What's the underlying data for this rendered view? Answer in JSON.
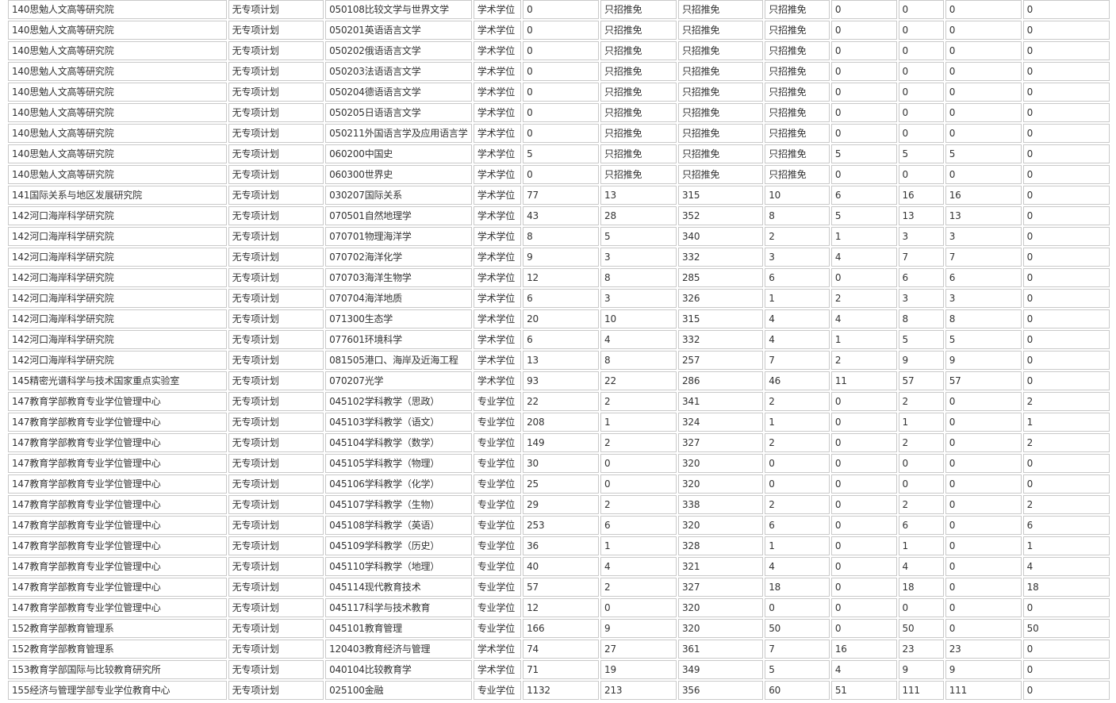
{
  "table": {
    "rows": [
      [
        "140思勉人文高等研究院",
        "无专项计划",
        "050108比较文学与世界文学",
        "学术学位",
        "0",
        "只招推免",
        "只招推免",
        "只招推免",
        "0",
        "0",
        "0",
        "0"
      ],
      [
        "140思勉人文高等研究院",
        "无专项计划",
        "050201英语语言文学",
        "学术学位",
        "0",
        "只招推免",
        "只招推免",
        "只招推免",
        "0",
        "0",
        "0",
        "0"
      ],
      [
        "140思勉人文高等研究院",
        "无专项计划",
        "050202俄语语言文学",
        "学术学位",
        "0",
        "只招推免",
        "只招推免",
        "只招推免",
        "0",
        "0",
        "0",
        "0"
      ],
      [
        "140思勉人文高等研究院",
        "无专项计划",
        "050203法语语言文学",
        "学术学位",
        "0",
        "只招推免",
        "只招推免",
        "只招推免",
        "0",
        "0",
        "0",
        "0"
      ],
      [
        "140思勉人文高等研究院",
        "无专项计划",
        "050204德语语言文学",
        "学术学位",
        "0",
        "只招推免",
        "只招推免",
        "只招推免",
        "0",
        "0",
        "0",
        "0"
      ],
      [
        "140思勉人文高等研究院",
        "无专项计划",
        "050205日语语言文学",
        "学术学位",
        "0",
        "只招推免",
        "只招推免",
        "只招推免",
        "0",
        "0",
        "0",
        "0"
      ],
      [
        "140思勉人文高等研究院",
        "无专项计划",
        "050211外国语言学及应用语言学",
        "学术学位",
        "0",
        "只招推免",
        "只招推免",
        "只招推免",
        "0",
        "0",
        "0",
        "0"
      ],
      [
        "140思勉人文高等研究院",
        "无专项计划",
        "060200中国史",
        "学术学位",
        "5",
        "只招推免",
        "只招推免",
        "只招推免",
        "5",
        "5",
        "5",
        "0"
      ],
      [
        "140思勉人文高等研究院",
        "无专项计划",
        "060300世界史",
        "学术学位",
        "0",
        "只招推免",
        "只招推免",
        "只招推免",
        "0",
        "0",
        "0",
        "0"
      ],
      [
        "141国际关系与地区发展研究院",
        "无专项计划",
        "030207国际关系",
        "学术学位",
        "77",
        "13",
        "315",
        "10",
        "6",
        "16",
        "16",
        "0"
      ],
      [
        "142河口海岸科学研究院",
        "无专项计划",
        "070501自然地理学",
        "学术学位",
        "43",
        "28",
        "352",
        "8",
        "5",
        "13",
        "13",
        "0"
      ],
      [
        "142河口海岸科学研究院",
        "无专项计划",
        "070701物理海洋学",
        "学术学位",
        "8",
        "5",
        "340",
        "2",
        "1",
        "3",
        "3",
        "0"
      ],
      [
        "142河口海岸科学研究院",
        "无专项计划",
        "070702海洋化学",
        "学术学位",
        "9",
        "3",
        "332",
        "3",
        "4",
        "7",
        "7",
        "0"
      ],
      [
        "142河口海岸科学研究院",
        "无专项计划",
        "070703海洋生物学",
        "学术学位",
        "12",
        "8",
        "285",
        "6",
        "0",
        "6",
        "6",
        "0"
      ],
      [
        "142河口海岸科学研究院",
        "无专项计划",
        "070704海洋地质",
        "学术学位",
        "6",
        "3",
        "326",
        "1",
        "2",
        "3",
        "3",
        "0"
      ],
      [
        "142河口海岸科学研究院",
        "无专项计划",
        "071300生态学",
        "学术学位",
        "20",
        "10",
        "315",
        "4",
        "4",
        "8",
        "8",
        "0"
      ],
      [
        "142河口海岸科学研究院",
        "无专项计划",
        "077601环境科学",
        "学术学位",
        "6",
        "4",
        "332",
        "4",
        "1",
        "5",
        "5",
        "0"
      ],
      [
        "142河口海岸科学研究院",
        "无专项计划",
        "081505港口、海岸及近海工程",
        "学术学位",
        "13",
        "8",
        "257",
        "7",
        "2",
        "9",
        "9",
        "0"
      ],
      [
        "145精密光谱科学与技术国家重点实验室",
        "无专项计划",
        "070207光学",
        "学术学位",
        "93",
        "22",
        "286",
        "46",
        "11",
        "57",
        "57",
        "0"
      ],
      [
        "147教育学部教育专业学位管理中心",
        "无专项计划",
        "045102学科教学（思政）",
        "专业学位",
        "22",
        "2",
        "341",
        "2",
        "0",
        "2",
        "0",
        "2"
      ],
      [
        "147教育学部教育专业学位管理中心",
        "无专项计划",
        "045103学科教学（语文）",
        "专业学位",
        "208",
        "1",
        "324",
        "1",
        "0",
        "1",
        "0",
        "1"
      ],
      [
        "147教育学部教育专业学位管理中心",
        "无专项计划",
        "045104学科教学（数学）",
        "专业学位",
        "149",
        "2",
        "327",
        "2",
        "0",
        "2",
        "0",
        "2"
      ],
      [
        "147教育学部教育专业学位管理中心",
        "无专项计划",
        "045105学科教学（物理）",
        "专业学位",
        "30",
        "0",
        "320",
        "0",
        "0",
        "0",
        "0",
        "0"
      ],
      [
        "147教育学部教育专业学位管理中心",
        "无专项计划",
        "045106学科教学（化学）",
        "专业学位",
        "25",
        "0",
        "320",
        "0",
        "0",
        "0",
        "0",
        "0"
      ],
      [
        "147教育学部教育专业学位管理中心",
        "无专项计划",
        "045107学科教学（生物）",
        "专业学位",
        "29",
        "2",
        "338",
        "2",
        "0",
        "2",
        "0",
        "2"
      ],
      [
        "147教育学部教育专业学位管理中心",
        "无专项计划",
        "045108学科教学（英语）",
        "专业学位",
        "253",
        "6",
        "320",
        "6",
        "0",
        "6",
        "0",
        "6"
      ],
      [
        "147教育学部教育专业学位管理中心",
        "无专项计划",
        "045109学科教学（历史）",
        "专业学位",
        "36",
        "1",
        "328",
        "1",
        "0",
        "1",
        "0",
        "1"
      ],
      [
        "147教育学部教育专业学位管理中心",
        "无专项计划",
        "045110学科教学（地理）",
        "专业学位",
        "40",
        "4",
        "321",
        "4",
        "0",
        "4",
        "0",
        "4"
      ],
      [
        "147教育学部教育专业学位管理中心",
        "无专项计划",
        "045114现代教育技术",
        "专业学位",
        "57",
        "2",
        "327",
        "18",
        "0",
        "18",
        "0",
        "18"
      ],
      [
        "147教育学部教育专业学位管理中心",
        "无专项计划",
        "045117科学与技术教育",
        "专业学位",
        "12",
        "0",
        "320",
        "0",
        "0",
        "0",
        "0",
        "0"
      ],
      [
        "152教育学部教育管理系",
        "无专项计划",
        "045101教育管理",
        "专业学位",
        "166",
        "9",
        "320",
        "50",
        "0",
        "50",
        "0",
        "50"
      ],
      [
        "152教育学部教育管理系",
        "无专项计划",
        "120403教育经济与管理",
        "学术学位",
        "74",
        "27",
        "361",
        "7",
        "16",
        "23",
        "23",
        "0"
      ],
      [
        "153教育学部国际与比较教育研究所",
        "无专项计划",
        "040104比较教育学",
        "学术学位",
        "71",
        "19",
        "349",
        "5",
        "4",
        "9",
        "9",
        "0"
      ],
      [
        "155经济与管理学部专业学位教育中心",
        "无专项计划",
        "025100金融",
        "专业学位",
        "1132",
        "213",
        "356",
        "60",
        "51",
        "111",
        "111",
        "0"
      ]
    ]
  }
}
